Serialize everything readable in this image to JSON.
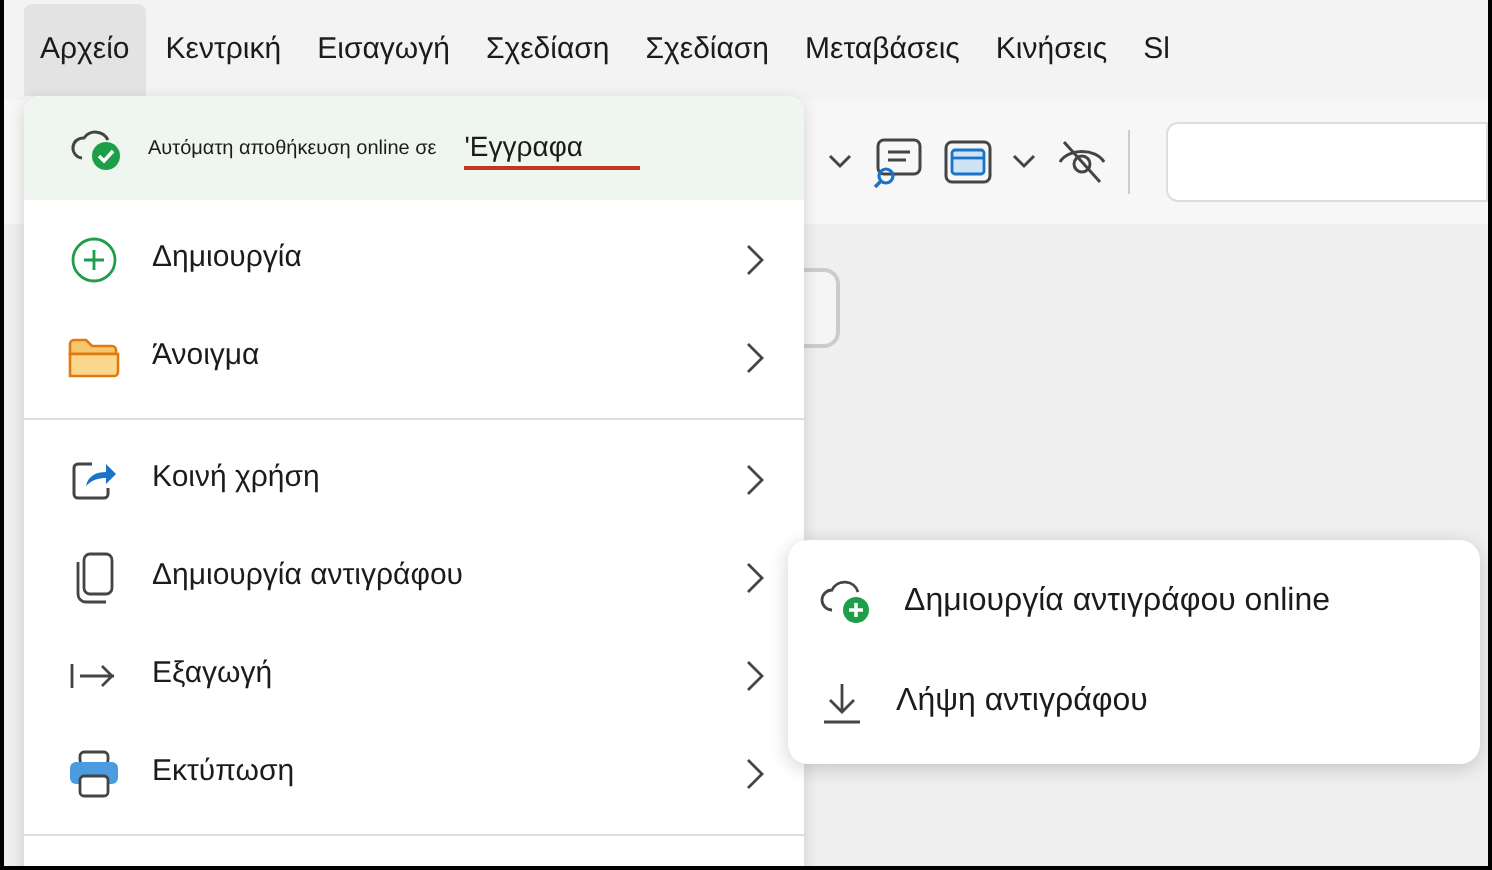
{
  "ribbon": {
    "tabs": [
      {
        "label": "Αρχείο",
        "selected": true
      },
      {
        "label": "Κεντρική",
        "selected": false
      },
      {
        "label": "Εισαγωγή",
        "selected": false
      },
      {
        "label": "Σχεδίαση",
        "selected": false
      },
      {
        "label": "Σχεδίαση",
        "selected": false
      },
      {
        "label": "Μεταβάσεις",
        "selected": false
      },
      {
        "label": "Κινήσεις",
        "selected": false
      },
      {
        "label": "Sl",
        "selected": false
      }
    ]
  },
  "file_menu": {
    "autosave": {
      "label": "Αυτόματη αποθήκευση online σε",
      "location": "'Εγγραφα"
    },
    "groups": [
      [
        {
          "label": "Δημιουργία"
        },
        {
          "label": "Άνοιγμα"
        }
      ],
      [
        {
          "label": "Κοινή χρήση"
        },
        {
          "label": "Δημιουργία αντιγράφου"
        },
        {
          "label": "Εξαγωγή"
        },
        {
          "label": "Εκτύπωση"
        }
      ]
    ]
  },
  "submenu": {
    "items": [
      {
        "label": "Δημιουργία αντιγράφου online"
      },
      {
        "label": "Λήψη αντιγράφου"
      }
    ]
  }
}
